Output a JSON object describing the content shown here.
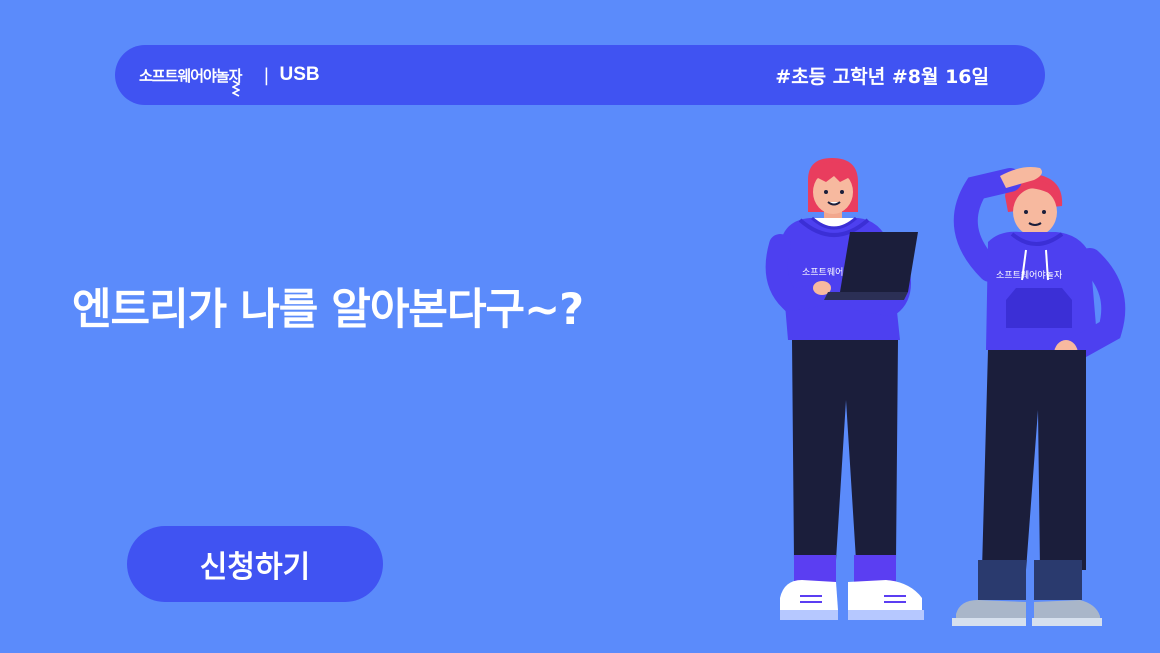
{
  "header": {
    "logo_text": "소프트웨어야놀자",
    "divider": "|",
    "category": "USB",
    "tags": "#초등 고학년 #8월 16일"
  },
  "main": {
    "headline": "엔트리가 나를 알아본다구~?",
    "cta_label": "신청하기"
  },
  "illustration": {
    "hoodie_text_left": "소프트웨어야놀자",
    "hoodie_text_right": "소프트웨어야놀자"
  },
  "colors": {
    "background": "#5b8bfb",
    "accent": "#4053f2",
    "text": "#ffffff"
  }
}
